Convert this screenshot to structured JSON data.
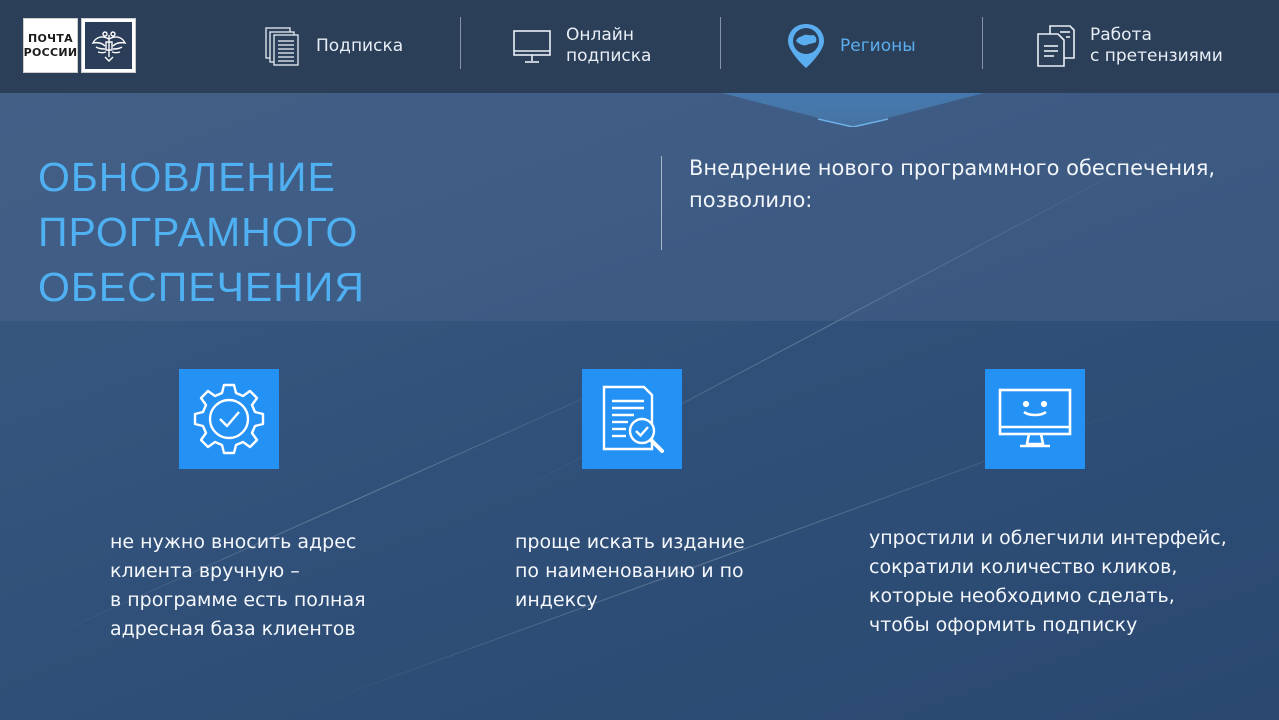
{
  "logo": {
    "line1": "ПОЧТА",
    "line2": "РОССИИ"
  },
  "nav": [
    {
      "label": "Подписка",
      "icon": "documents-icon"
    },
    {
      "label_line1": "Онлайн",
      "label_line2": "подписка",
      "icon": "monitor-icon"
    },
    {
      "label": "Регионы",
      "icon": "map-pin-icon",
      "active": true
    },
    {
      "label_line1": "Работа",
      "label_line2": "с претензиями",
      "icon": "claims-document-icon"
    }
  ],
  "section": {
    "title_line1": "ОБНОВЛЕНИЕ ПРОГРАМНОГО",
    "title_line2": "ОБЕСПЕЧЕНИЯ",
    "intro": "Внедрение нового программного обеспечения, позволило:"
  },
  "features": [
    {
      "icon": "gear-check-icon",
      "lines": [
        "не нужно вносить адрес",
        "клиента вручную –",
        "в программе есть полная",
        "адресная база клиентов"
      ]
    },
    {
      "icon": "document-search-icon",
      "lines": [
        "проще искать издание",
        "по наименованию и по",
        "индексу"
      ]
    },
    {
      "icon": "monitor-smile-icon",
      "lines": [
        "упростили и облегчили интерфейс,",
        "сократили количество кликов,",
        "которые необходимо сделать,",
        "чтобы оформить подписку"
      ]
    }
  ],
  "colors": {
    "accent": "#2491f5",
    "title": "#4fb0f2",
    "header": "#2c3f58",
    "active_nav": "#5aaef0"
  }
}
